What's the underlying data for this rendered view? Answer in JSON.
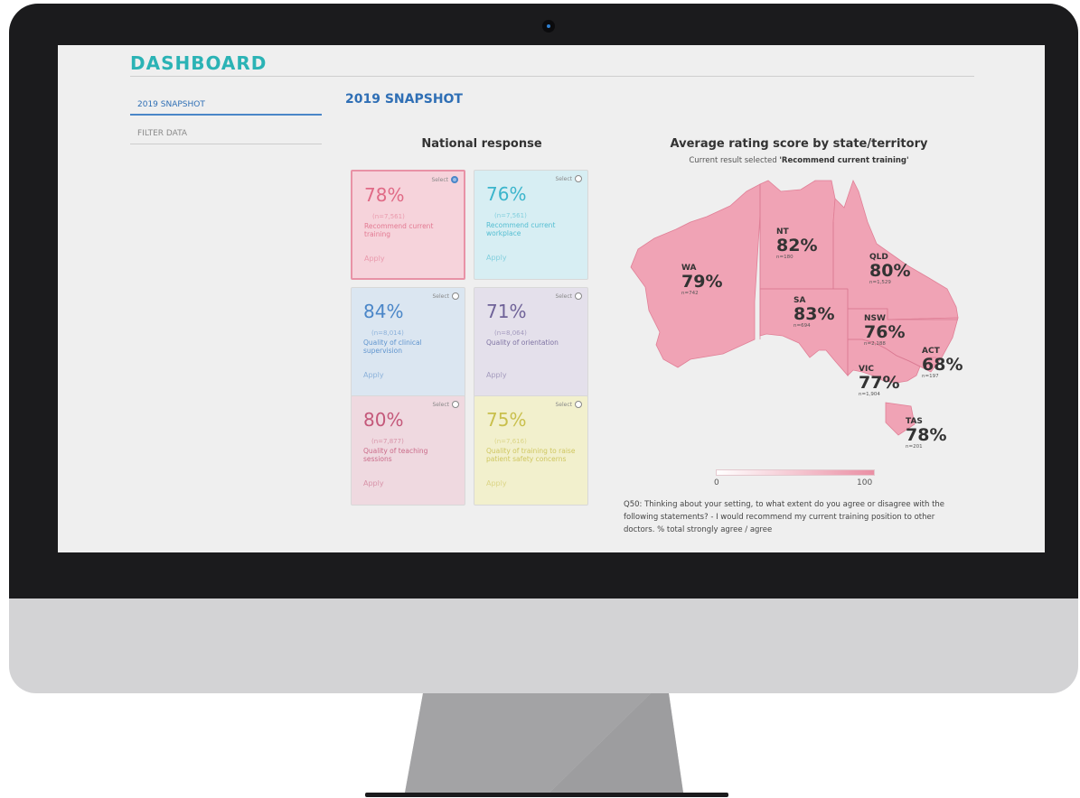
{
  "dashboard": {
    "title": "DASHBOARD",
    "sidebar": {
      "items": [
        {
          "label": "2019 SNAPSHOT",
          "active": true
        },
        {
          "label": "FILTER DATA",
          "active": false
        }
      ]
    },
    "section_title": "2019 SNAPSHOT",
    "national": {
      "title": "National response",
      "select_label": "Select",
      "apply_label": "Apply",
      "cards": [
        {
          "pct": "78%",
          "n": "(n=7,561)",
          "desc": "Recommend current training",
          "selected": true,
          "bg": "#f6d3db",
          "fg": "#e06a86",
          "border": "#e892a6"
        },
        {
          "pct": "76%",
          "n": "(n=7,561)",
          "desc": "Recommend current workplace",
          "selected": false,
          "bg": "#d7eef3",
          "fg": "#3bb5cc",
          "border": "#d8d8d8"
        },
        {
          "pct": "84%",
          "n": "(n=8,014)",
          "desc": "Quality of clinical supervision",
          "selected": false,
          "bg": "#dbe6f1",
          "fg": "#4a86c8",
          "border": "#d8d8d8"
        },
        {
          "pct": "71%",
          "n": "(n=8,064)",
          "desc": "Quality of orientation",
          "selected": false,
          "bg": "#e4e0eb",
          "fg": "#6f6298",
          "border": "#d8d8d8"
        },
        {
          "pct": "80%",
          "n": "(n=7,877)",
          "desc": "Quality of teaching sessions",
          "selected": false,
          "bg": "#efd9e0",
          "fg": "#c4587a",
          "border": "#d8d8d8"
        },
        {
          "pct": "75%",
          "n": "(n=7,616)",
          "desc": "Quality of training to raise patient safety concerns",
          "selected": false,
          "bg": "#f2f0cd",
          "fg": "#c9bf4c",
          "border": "#d8d8d8"
        }
      ]
    },
    "map": {
      "title": "Average rating score by state/territory",
      "subtitle_prefix": "Current result selected ",
      "subtitle_value": "'Recommend current training'",
      "fill_color": "#f0a3b5",
      "states": [
        {
          "abbr": "WA",
          "value": "79%",
          "n": "n=742"
        },
        {
          "abbr": "NT",
          "value": "82%",
          "n": "n=180"
        },
        {
          "abbr": "SA",
          "value": "83%",
          "n": "n=694"
        },
        {
          "abbr": "QLD",
          "value": "80%",
          "n": "n=1,529"
        },
        {
          "abbr": "NSW",
          "value": "76%",
          "n": "n=2,188"
        },
        {
          "abbr": "ACT",
          "value": "68%",
          "n": "n=197"
        },
        {
          "abbr": "VIC",
          "value": "77%",
          "n": "n=1,904"
        },
        {
          "abbr": "TAS",
          "value": "78%",
          "n": "n=201"
        }
      ],
      "legend": {
        "min": "0",
        "max": "100"
      },
      "question": "Q50: Thinking about your setting, to what extent do you agree or disagree with the following statements? - I would recommend my current training position to other doctors. % total strongly agree / agree"
    }
  }
}
